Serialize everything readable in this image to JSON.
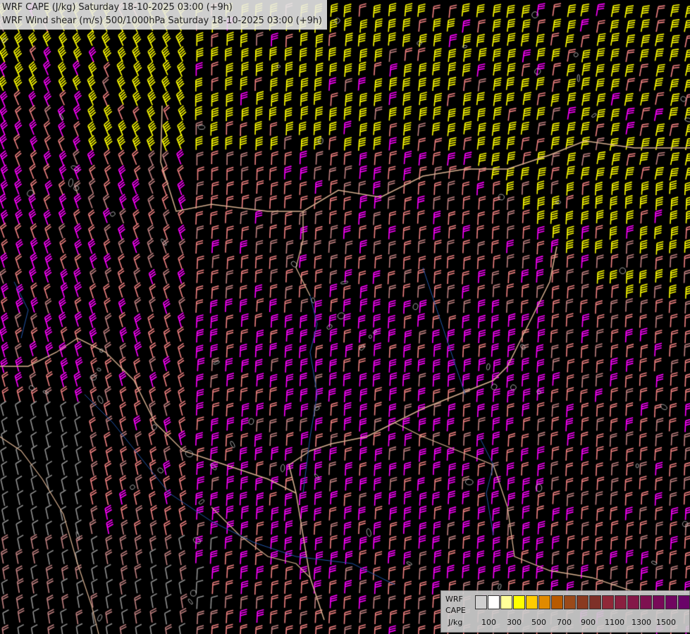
{
  "title": {
    "line1": "WRF CAPE (J/kg) Saturday 18-10-2025 03:00 (+9h)",
    "line2": "WRF Wind shear (m/s) 500/1000hPa Saturday 18-10-2025 03:00 (+9h)"
  },
  "legend": {
    "label_line1": "WRF",
    "label_line2": "CAPE",
    "label_line3": "J/kg",
    "swatches": [
      "#cfcfcf",
      "#ffffff",
      "#ffff99",
      "#ffff00",
      "#ffcc00",
      "#e08a00",
      "#b85a00",
      "#9a4a1a",
      "#8a3a20",
      "#7e3028",
      "#902838",
      "#8a2040",
      "#841848",
      "#7e1050",
      "#780a58",
      "#700660",
      "#6a0468",
      "#64006e"
    ],
    "ticks": [
      "100",
      "300",
      "500",
      "700",
      "900",
      "1100",
      "1300",
      "1500"
    ]
  },
  "colors": {
    "background": "#000000",
    "barb_yellow": "#ffff00",
    "barb_magenta": "#ff00ff",
    "barb_salmon": "#f08080",
    "barb_rose": "#c08080",
    "barb_grey": "#909090",
    "border": "#d8b090",
    "river": "#2255aa",
    "coast": "#cfcfcf"
  }
}
